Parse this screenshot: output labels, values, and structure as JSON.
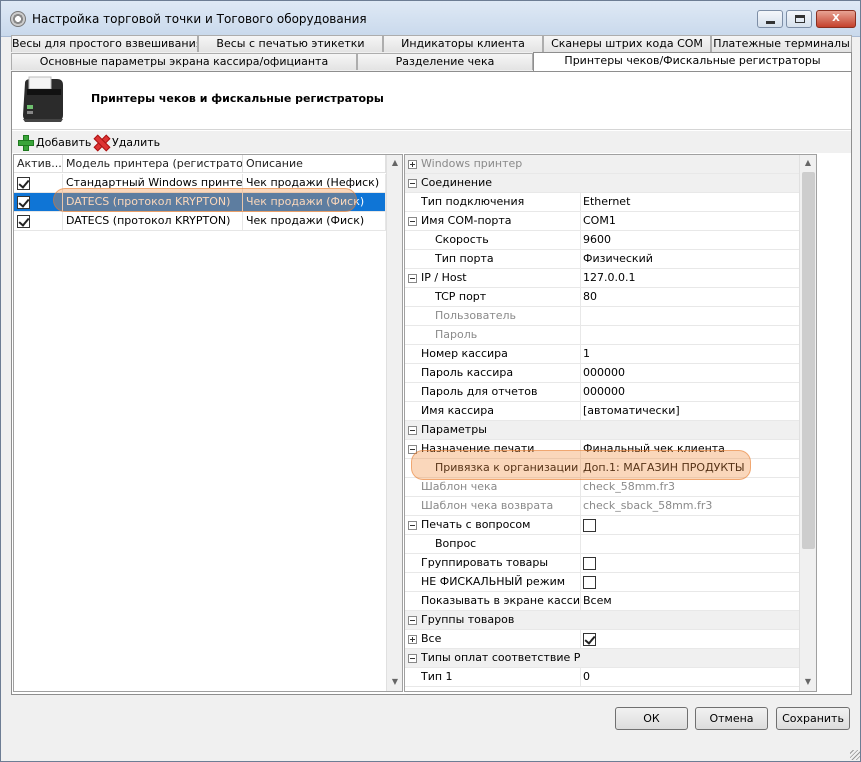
{
  "window": {
    "title": "Настройка торговой точки и Тогового оборудования",
    "controls": {
      "minimize": "",
      "maximize": "",
      "close": "X"
    }
  },
  "tabs": {
    "row1": [
      "Весы для простого взвешивания",
      "Весы с печатью этикетки",
      "Индикаторы клиента",
      "Сканеры штрих кода COM",
      "Платежные терминалы"
    ],
    "row2": [
      "Основные параметры экрана кассира/официанта",
      "Разделение чека",
      "Принтеры чеков/Фискальные регистраторы"
    ],
    "active": "Принтеры чеков/Фискальные регистраторы"
  },
  "panel": {
    "title": "Принтеры чеков и фискальные регистраторы",
    "icon": "receipt-printer-icon"
  },
  "toolbar": {
    "add_label": "Добавить",
    "delete_label": "Удалить"
  },
  "grid": {
    "columns": [
      "Актив...",
      "Модель принтера (регистратора)",
      "Описание"
    ],
    "rows": [
      {
        "active": true,
        "model": "Стандартный Windows принтер",
        "description": "Чек продажи (Нефиск)",
        "selected": false
      },
      {
        "active": true,
        "model": "DATECS (протокол KRYPTON)",
        "description": "Чек продажи (Фиск)",
        "selected": true
      },
      {
        "active": true,
        "model": "DATECS (протокол KRYPTON)",
        "description": "Чек продажи (Фиск)",
        "selected": false
      }
    ]
  },
  "properties": [
    {
      "type": "cat",
      "expander": "plus",
      "indent": 0,
      "name": "Windows принтер",
      "value": "",
      "disabled": true
    },
    {
      "type": "cat",
      "expander": "minus",
      "indent": 0,
      "name": "Соединение",
      "value": ""
    },
    {
      "type": "prop",
      "indent": 1,
      "name": "Тип подключения",
      "value": "Ethernet"
    },
    {
      "type": "prop",
      "expander": "minus",
      "indent": 1,
      "name": "Имя COM-порта",
      "value": "COM1"
    },
    {
      "type": "prop",
      "indent": 2,
      "name": "Скорость",
      "value": "9600"
    },
    {
      "type": "prop",
      "indent": 2,
      "name": "Тип порта",
      "value": "Физический"
    },
    {
      "type": "prop",
      "expander": "minus",
      "indent": 1,
      "name": "IP / Host",
      "value": "127.0.0.1"
    },
    {
      "type": "prop",
      "indent": 2,
      "name": "TCP порт",
      "value": "80"
    },
    {
      "type": "prop",
      "indent": 2,
      "name": "Пользователь",
      "value": "",
      "disabled": true
    },
    {
      "type": "prop",
      "indent": 2,
      "name": "Пароль",
      "value": "",
      "disabled": true
    },
    {
      "type": "prop",
      "indent": 1,
      "name": "Номер кассира",
      "value": "1"
    },
    {
      "type": "prop",
      "indent": 1,
      "name": "Пароль кассира",
      "value": "000000"
    },
    {
      "type": "prop",
      "indent": 1,
      "name": "Пароль для отчетов",
      "value": "000000"
    },
    {
      "type": "prop",
      "indent": 1,
      "name": "Имя кассира",
      "value": "[автоматически]"
    },
    {
      "type": "cat",
      "expander": "minus",
      "indent": 0,
      "name": "Параметры",
      "value": ""
    },
    {
      "type": "prop",
      "expander": "minus",
      "indent": 1,
      "name": "Назначение печати",
      "value": "Финальный чек клиента"
    },
    {
      "type": "prop",
      "indent": 2,
      "name": "Привязка к организации",
      "value": "Доп.1: МАГАЗИН ПРОДУКТЫ"
    },
    {
      "type": "prop",
      "indent": 1,
      "name": "Шаблон чека",
      "value": "check_58mm.fr3",
      "disabled": true
    },
    {
      "type": "prop",
      "indent": 1,
      "name": "Шаблон чека возврата",
      "value": "check_sback_58mm.fr3",
      "disabled": true
    },
    {
      "type": "prop",
      "expander": "minus",
      "indent": 1,
      "name": "Печать с вопросом",
      "checkbox": true,
      "checked": false
    },
    {
      "type": "prop",
      "indent": 2,
      "name": "Вопрос",
      "value": ""
    },
    {
      "type": "prop",
      "indent": 1,
      "name": "Группировать товары",
      "checkbox": true,
      "checked": false
    },
    {
      "type": "prop",
      "indent": 1,
      "name": "НЕ ФИСКАЛЬНЫЙ режим",
      "checkbox": true,
      "checked": false
    },
    {
      "type": "prop",
      "indent": 1,
      "name": "Показывать в экране кассира/",
      "value": "Всем"
    },
    {
      "type": "cat",
      "expander": "minus",
      "indent": 0,
      "name": "Группы товаров",
      "value": ""
    },
    {
      "type": "prop",
      "expander": "plus",
      "indent": 1,
      "name": "Все",
      "checkbox": true,
      "checked": true
    },
    {
      "type": "cat",
      "expander": "minus",
      "indent": 0,
      "name": "Типы оплат соответствие РРО",
      "value": ""
    },
    {
      "type": "prop",
      "indent": 1,
      "name": "Тип 1",
      "value": "0"
    }
  ],
  "buttons": {
    "ok": "ОК",
    "cancel": "Отмена",
    "save": "Сохранить"
  },
  "colors": {
    "selection": "#0f75d6",
    "highlight": "#f08c3c"
  }
}
